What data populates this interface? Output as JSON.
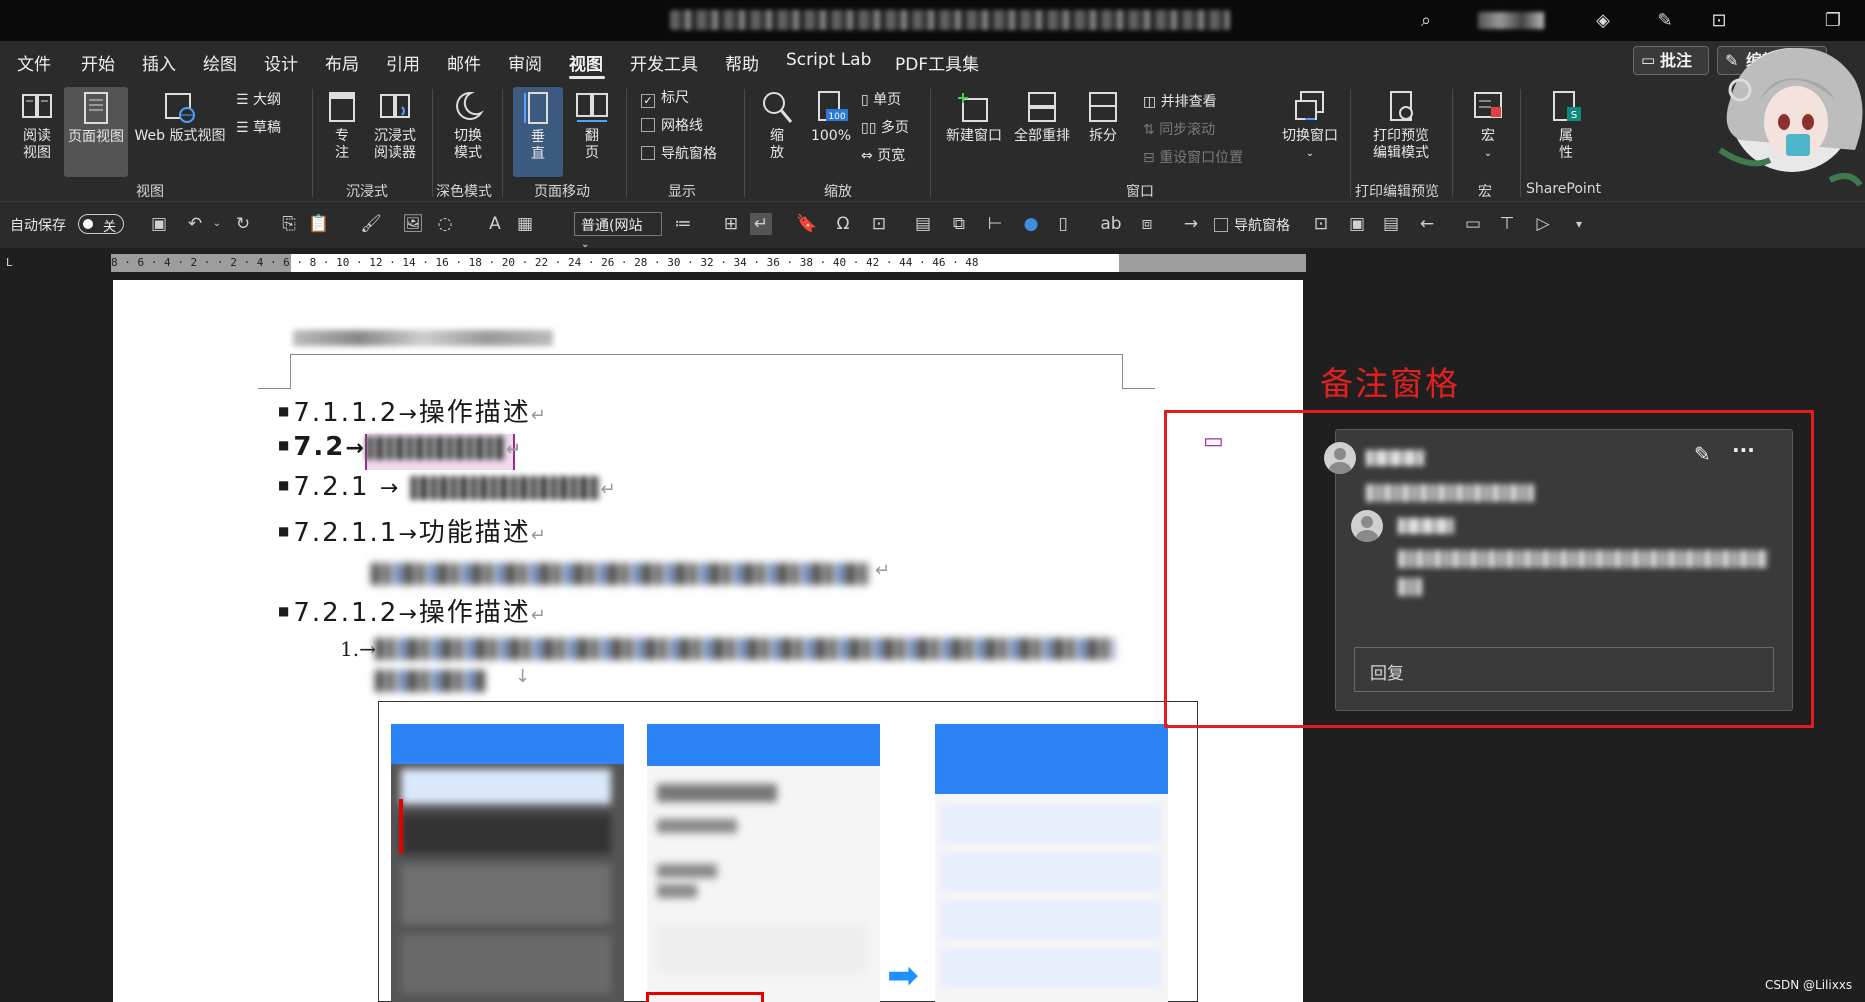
{
  "menu": {
    "tabs": [
      "文件",
      "开始",
      "插入",
      "绘图",
      "设计",
      "布局",
      "引用",
      "邮件",
      "审阅",
      "视图",
      "开发工具",
      "帮助",
      "Script Lab",
      "PDF工具集"
    ],
    "comment_btn": "批注",
    "edit_btn": "编辑"
  },
  "ribbon": {
    "view": {
      "read": "阅读\n视图",
      "page": "页面视图",
      "web": "Web 版式视图",
      "outline": "大纲",
      "draft": "草稿",
      "label": "视图"
    },
    "immersive": {
      "focus": "专\n注",
      "reader": "沉浸式\n阅读器",
      "label": "沉浸式"
    },
    "dark": {
      "toggle": "切换\n模式",
      "label": "深色模式"
    },
    "pagemove": {
      "vertical": "垂\n直",
      "flip": "翻\n页",
      "label": "页面移动"
    },
    "show": {
      "ruler": "标尺",
      "grid": "网格线",
      "nav": "导航窗格",
      "label": "显示"
    },
    "zoom": {
      "zoom": "缩\n放",
      "hundred": "100%",
      "one": "单页",
      "multi": "多页",
      "width": "页宽",
      "label": "缩放",
      "icon_text": "100"
    },
    "window": {
      "new": "新建窗口",
      "arrange": "全部重排",
      "split": "拆分",
      "side": "并排查看",
      "sync": "同步滚动",
      "reset": "重设窗口位置",
      "switch": "切换窗口",
      "label": "窗口"
    },
    "print": {
      "preview": "打印预览\n编辑模式",
      "label": "打印编辑预览"
    },
    "macro": {
      "macro": "宏",
      "label": "宏"
    },
    "sharepoint": {
      "props": "属\n性",
      "label": "SharePoint"
    }
  },
  "qat": {
    "autosave": "自动保存",
    "toggle": "关",
    "style": "普通(网站",
    "nav": "导航窗格"
  },
  "ruler": {
    "corner": "L",
    "ticks": "8 · 6 · 4 · 2 ·   · 2 · 4 · 6 · 8 · 10 · 12 · 14 · 16 · 18 · 20 · 22 · 24 · 26 · 28 · 30 · 32 · 34 · 36 · 38 · 40 · 42 · 44 · 46 · 48"
  },
  "document": {
    "h1": "7.1.1.2",
    "h1_text": "操作描述",
    "h2": "7.2",
    "h3": "7.2.1",
    "h4": "7.2.1.1",
    "h4_text": "功能描述",
    "h5": "7.2.1.2",
    "h5_text": "操作描述",
    "arrow": "→",
    "para": "↵",
    "list_num": "1.→",
    "para_down": "↓"
  },
  "annotation": {
    "label": "备注窗格",
    "color": "#e11d1d"
  },
  "comment_pane": {
    "reply_placeholder": "回复"
  },
  "watermark": "CSDN @Lilixxs"
}
